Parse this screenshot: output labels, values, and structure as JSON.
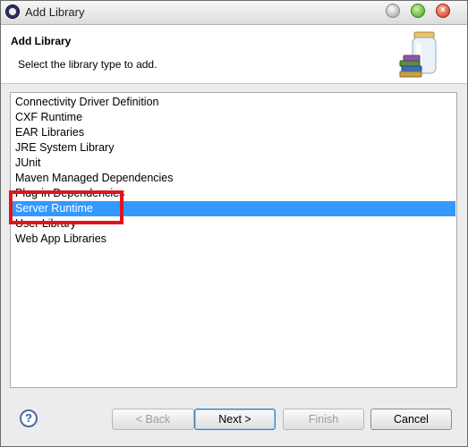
{
  "window": {
    "title": "Add Library"
  },
  "header": {
    "title": "Add Library",
    "description": "Select the library type to add."
  },
  "library_types": [
    "Connectivity Driver Definition",
    "CXF Runtime",
    "EAR Libraries",
    "JRE System Library",
    "JUnit",
    "Maven Managed Dependencies",
    "Plug-in Dependencies",
    "Server Runtime",
    "User Library",
    "Web App Libraries"
  ],
  "selected_item": "Server Runtime",
  "buttons": {
    "back": "< Back",
    "next": "Next >",
    "finish": "Finish",
    "cancel": "Cancel",
    "help": "?"
  },
  "colors": {
    "selection": "#3399ff",
    "annotation_box": "#e0141c"
  }
}
